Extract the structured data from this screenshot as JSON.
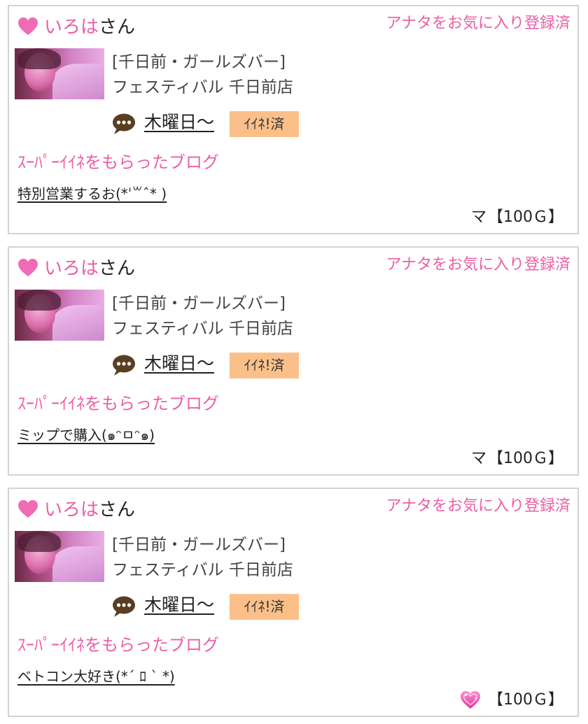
{
  "colors": {
    "accent_pink": "#ea5fa6",
    "badge_bg": "#fbc08a",
    "border": "#d3d3d3",
    "chat_icon": "#5a3e22"
  },
  "cards": [
    {
      "name": "いろは",
      "suffix": "さん",
      "favorite_status": "アナタをお気に入り登録済",
      "shop_line1": "[千日前・ガールズバー]",
      "shop_line2": "フェスティバル 千日前店",
      "day": "木曜日〜",
      "iine_badge": "ｲｲﾈ!済",
      "blog_heading": "ｽｰﾊﾟｰｲｲﾈをもらったブログ",
      "blog_entry": "特別営業するお(*ˈ꒳ˆ* )",
      "gift_prefix": "マ",
      "gift_icon": null,
      "gift_amount": "【100Ｇ】"
    },
    {
      "name": "いろは",
      "suffix": "さん",
      "favorite_status": "アナタをお気に入り登録済",
      "shop_line1": "[千日前・ガールズバー]",
      "shop_line2": "フェスティバル 千日前店",
      "day": "木曜日〜",
      "iine_badge": "ｲｲﾈ!済",
      "blog_heading": "ｽｰﾊﾟｰｲｲﾈをもらったブログ",
      "blog_entry": "ミップで購入(๑ᵔㅁᵔ๑)",
      "gift_prefix": "マ",
      "gift_icon": null,
      "gift_amount": "【100Ｇ】"
    },
    {
      "name": "いろは",
      "suffix": "さん",
      "favorite_status": "アナタをお気に入り登録済",
      "shop_line1": "[千日前・ガールズバー]",
      "shop_line2": "フェスティバル 千日前店",
      "day": "木曜日〜",
      "iine_badge": "ｲｲﾈ!済",
      "blog_heading": "ｽｰﾊﾟｰｲｲﾈをもらったブログ",
      "blog_entry": "ベトコン大好き(*´ ﾛ ` *)",
      "gift_prefix": "",
      "gift_icon": "sparkling-heart-icon",
      "gift_amount": "【100Ｇ】"
    }
  ]
}
